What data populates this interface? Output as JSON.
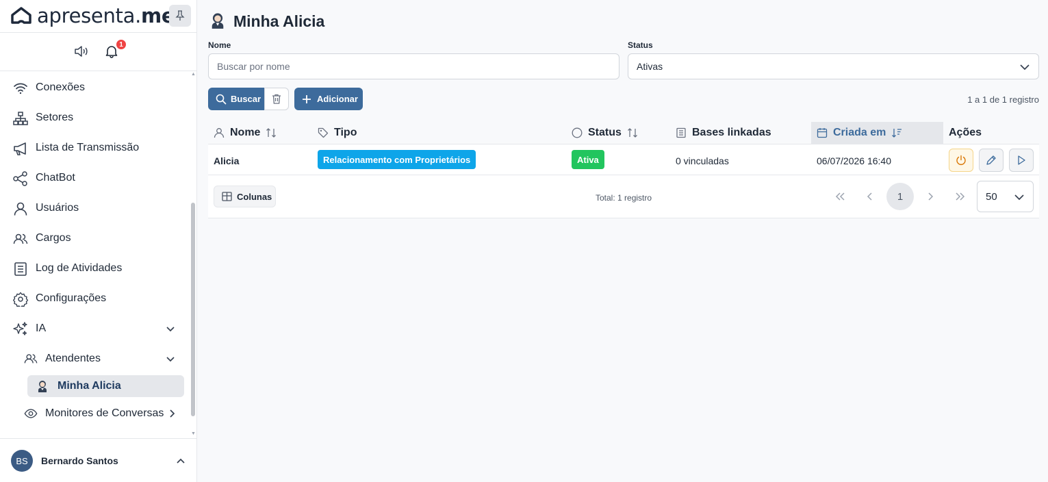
{
  "brand": {
    "logo_regular": "apresenta.",
    "logo_bold": "me"
  },
  "notifications": {
    "count": "1"
  },
  "sidebar": {
    "items": [
      {
        "label": "Conexões",
        "icon": "wifi-icon"
      },
      {
        "label": "Setores",
        "icon": "sitemap-icon"
      },
      {
        "label": "Lista de Transmissão",
        "icon": "megaphone-icon"
      },
      {
        "label": "ChatBot",
        "icon": "share-icon"
      },
      {
        "label": "Usuários",
        "icon": "user-icon"
      },
      {
        "label": "Cargos",
        "icon": "users-icon"
      },
      {
        "label": "Log de Atividades",
        "icon": "list-icon"
      },
      {
        "label": "Configurações",
        "icon": "gear-icon"
      },
      {
        "label": "IA",
        "icon": "sparkles-icon"
      }
    ],
    "sub_atendentes": "Atendentes",
    "active": "Minha Alicia",
    "sub_monitores": "Monitores de Conversas"
  },
  "user": {
    "initials": "BS",
    "name": "Bernardo Santos"
  },
  "page": {
    "title": "Minha Alicia"
  },
  "filters": {
    "name_label": "Nome",
    "name_placeholder": "Buscar por nome",
    "status_label": "Status",
    "status_value": "Ativas"
  },
  "toolbar": {
    "search_label": "Buscar",
    "add_label": "Adicionar",
    "count_text": "1 a 1 de 1 registro"
  },
  "table": {
    "headers": {
      "nome": "Nome",
      "tipo": "Tipo",
      "status": "Status",
      "bases": "Bases linkadas",
      "criada": "Criada em",
      "acoes": "Ações"
    },
    "rows": [
      {
        "nome": "Alicia",
        "tipo": "Relacionamento com Proprietários",
        "status": "Ativa",
        "bases": "0 vinculadas",
        "criada": "06/07/2026 16:40"
      }
    ]
  },
  "footer": {
    "columns_label": "Colunas",
    "total_text": "Total: 1 registro",
    "current_page": "1",
    "page_size": "50"
  },
  "colors": {
    "primary": "#3d6b9c",
    "tag_blue": "#0ea5e9",
    "tag_green": "#22c55e",
    "badge": "#ef4444"
  }
}
